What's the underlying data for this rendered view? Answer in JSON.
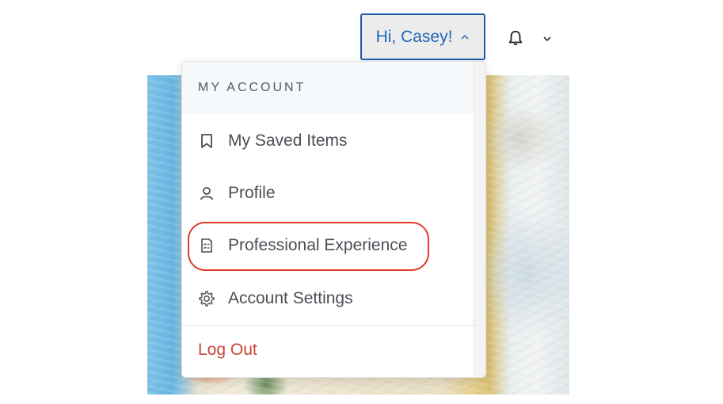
{
  "header": {
    "user_button_label": "Hi, Casey!",
    "user_button_icon": "chevron-up-icon",
    "notifications_icon": "bell-icon",
    "notifications_menu_icon": "chevron-down-icon"
  },
  "dropdown": {
    "heading": "MY ACCOUNT",
    "items": [
      {
        "label": "My Saved Items",
        "icon": "bookmark-icon"
      },
      {
        "label": "Profile",
        "icon": "user-icon"
      },
      {
        "label": "Professional Experience",
        "icon": "document-checklist-icon",
        "highlighted": true
      },
      {
        "label": "Account Settings",
        "icon": "gear-icon"
      }
    ],
    "logout_label": "Log Out"
  },
  "colors": {
    "accent": "#1f66b8",
    "highlight_ring": "#e0392a",
    "logout": "#c8453b",
    "menu_text": "#4a4f55"
  }
}
